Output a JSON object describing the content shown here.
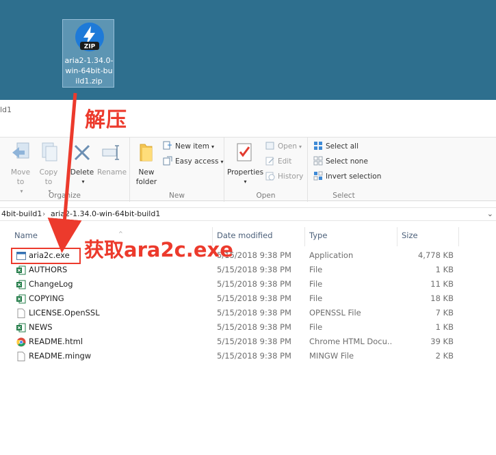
{
  "desktop": {
    "zip_file": {
      "icon_text": "ZIP",
      "label": "aria2-1.34.0-win-64bit-build1.zip"
    }
  },
  "window": {
    "title_fragment": "ld1"
  },
  "ribbon": {
    "organize": {
      "label": "Organize",
      "move_to": "Move to",
      "copy_to": "Copy to",
      "delete": "Delete",
      "rename": "Rename"
    },
    "new": {
      "label": "New",
      "new_item": "New item",
      "easy_access": "Easy access",
      "new_folder": "New folder"
    },
    "open": {
      "label": "Open",
      "properties": "Properties",
      "open": "Open",
      "edit": "Edit",
      "history": "History"
    },
    "select": {
      "label": "Select",
      "select_all": "Select all",
      "select_none": "Select none",
      "invert": "Invert selection"
    }
  },
  "address": {
    "previous": "4bit-build1",
    "separator": "›",
    "current": "aria2-1.34.0-win-64bit-build1"
  },
  "columns": {
    "name": "Name",
    "date": "Date modified",
    "type": "Type",
    "size": "Size"
  },
  "files": [
    {
      "name": "aria2c.exe",
      "date": "5/15/2018 9:38 PM",
      "type": "Application",
      "size": "4,778 KB",
      "icon": "app-icon"
    },
    {
      "name": "AUTHORS",
      "date": "5/15/2018 9:38 PM",
      "type": "File",
      "size": "1 KB",
      "icon": "excel-icon"
    },
    {
      "name": "ChangeLog",
      "date": "5/15/2018 9:38 PM",
      "type": "File",
      "size": "11 KB",
      "icon": "excel-icon"
    },
    {
      "name": "COPYING",
      "date": "5/15/2018 9:38 PM",
      "type": "File",
      "size": "18 KB",
      "icon": "excel-icon"
    },
    {
      "name": "LICENSE.OpenSSL",
      "date": "5/15/2018 9:38 PM",
      "type": "OPENSSL File",
      "size": "7 KB",
      "icon": "blank-file-icon"
    },
    {
      "name": "NEWS",
      "date": "5/15/2018 9:38 PM",
      "type": "File",
      "size": "1 KB",
      "icon": "excel-icon"
    },
    {
      "name": "README.html",
      "date": "5/15/2018 9:38 PM",
      "type": "Chrome HTML Docu...",
      "size": "39 KB",
      "icon": "chrome-icon"
    },
    {
      "name": "README.mingw",
      "date": "5/15/2018 9:38 PM",
      "type": "MINGW File",
      "size": "2 KB",
      "icon": "blank-file-icon"
    }
  ],
  "annotations": {
    "extract": "解压",
    "get": "获取ara2c.exe",
    "color": "#ec3a2c"
  }
}
